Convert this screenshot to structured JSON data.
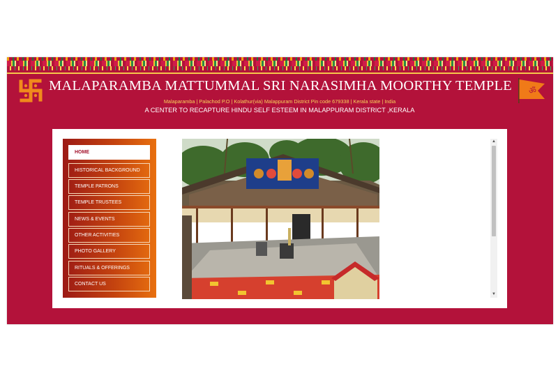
{
  "header": {
    "title": "MALAPARAMBA MATTUMMAL SRI NARASIMHA MOORTHY TEMPLE",
    "address": "Malaparamba | Palachod P.O | Kolathur(via) Malappuram District Pin code 679338 | Kerala state | India",
    "tagline": "A CENTER TO RECAPTURE HINDU SELF ESTEEM IN MALAPPURAM DISTRICT ,KERALA",
    "left_emblem_icon": "swastika-icon",
    "right_emblem_icon": "om-flag-icon"
  },
  "nav": {
    "items": [
      {
        "label": "HOME",
        "active": true
      },
      {
        "label": "HISTORICAL BACKGROUND"
      },
      {
        "label": "TEMPLE PATRONS"
      },
      {
        "label": "TEMPLE TRUSTEES"
      },
      {
        "label": "NEWS & EVENTS"
      },
      {
        "label": "OTHER ACTIVITIES"
      },
      {
        "label": "PHOTO GALLERY"
      },
      {
        "label": "RITUALS & OFFERINGS"
      },
      {
        "label": "CONTACT US"
      }
    ]
  },
  "scrollbar": {
    "up_icon": "scroll-up-icon",
    "down_icon": "scroll-down-icon"
  },
  "colors": {
    "brand": "#b3123a",
    "saffron": "#e8700f",
    "accent": "#f6c84a"
  }
}
